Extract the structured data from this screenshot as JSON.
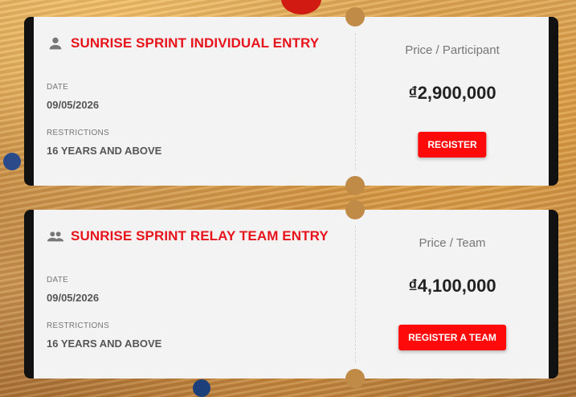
{
  "tickets": [
    {
      "title": "SUNRISE SPRINT INDIVIDUAL ENTRY",
      "icon": "person-icon",
      "date_label": "DATE",
      "date": "09/05/2026",
      "restrictions_label": "RESTRICTIONS",
      "restrictions": "16 YEARS AND ABOVE",
      "price_label": "Price / Participant",
      "price": "₫2,900,000",
      "button_label": "REGISTER"
    },
    {
      "title": "SUNRISE SPRINT RELAY TEAM ENTRY",
      "icon": "group-icon",
      "date_label": "DATE",
      "date": "09/05/2026",
      "restrictions_label": "RESTRICTIONS",
      "restrictions": "16 YEARS AND ABOVE",
      "price_label": "Price / Team",
      "price": "₫4,100,000",
      "button_label": "REGISTER A TEAM"
    }
  ],
  "colors": {
    "accent": "#e8141c",
    "button": "#ff0a0a",
    "card": "#f3f3f3",
    "frame": "#111111"
  }
}
